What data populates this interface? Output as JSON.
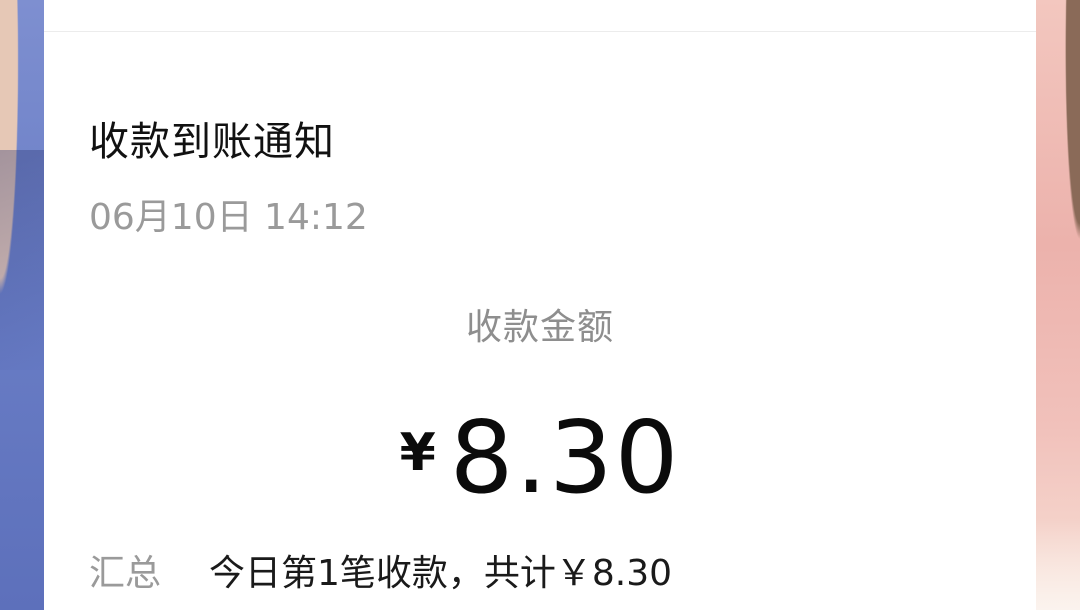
{
  "notification": {
    "title": "收款到账通知",
    "timestamp": "06月10日 14:12",
    "amount_label": "收款金额",
    "currency_symbol": "¥",
    "amount": "8.30",
    "summary": {
      "key": "汇总",
      "value": "今日第1笔收款，共计￥8.30"
    }
  },
  "colors": {
    "card_background": "#ffffff",
    "title_text": "#111111",
    "secondary_text": "#9a9a9a",
    "amount_text": "#0b0b0b"
  }
}
